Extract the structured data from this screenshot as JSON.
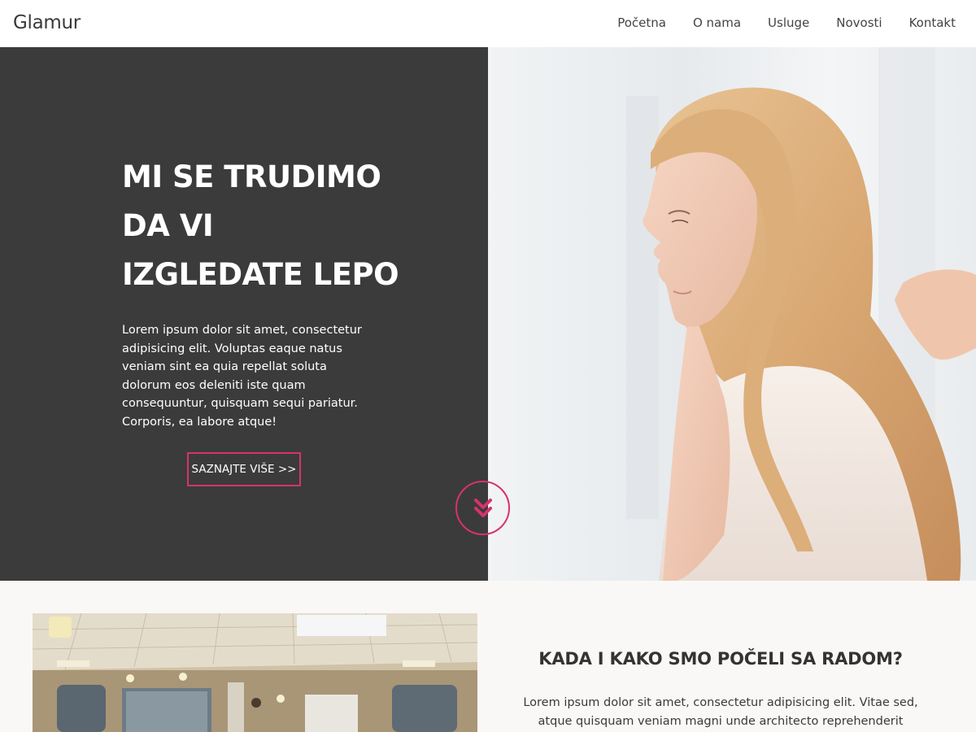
{
  "header": {
    "logo": "Glamur",
    "nav": [
      "Početna",
      "O nama",
      "Usluge",
      "Novosti",
      "Kontakt"
    ]
  },
  "hero": {
    "title_lines": [
      "MI SE TRUDIMO",
      "DA VI",
      "IZGLEDATE LEPO"
    ],
    "text": "Lorem ipsum dolor sit amet, consectetur adipisicing elit. Voluptas eaque natus veniam sint ea quia repellat soluta dolorum eos deleniti iste quam consequuntur, quisquam sequi pariatur. Corporis, ea labore atque!",
    "button_label": "SAZNAJTE VIŠE >>",
    "scroll_icon": "double-chevron-down-icon"
  },
  "about": {
    "title": "KADA I KAKO SMO POČELI SA RADOM?",
    "text": "Lorem ipsum dolor sit amet, consectetur adipisicing elit. Vitae sed, atque quisquam veniam magni unde architecto reprehenderit"
  },
  "colors": {
    "accent": "#d6336c",
    "hero_dark": "#3b3b3b",
    "section_bg": "#faf8f6"
  }
}
